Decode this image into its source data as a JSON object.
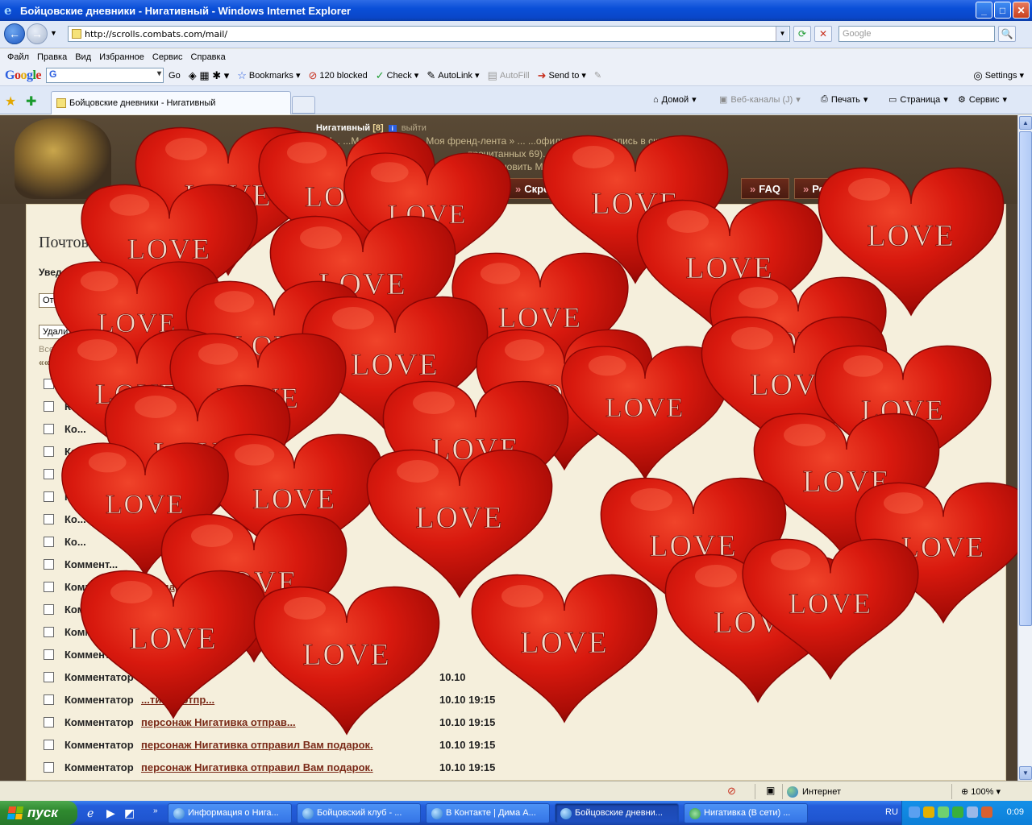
{
  "window": {
    "title": "Бойцовские дневники - Нигативный - Windows Internet Explorer",
    "ie_glyph": "e",
    "minimize": "_",
    "maximize": "□",
    "close": "✕"
  },
  "address": {
    "url": "http://scrolls.combats.com/mail/",
    "search_placeholder": "Google",
    "back": "←",
    "forward": "→",
    "refresh": "⟳",
    "stop": "✕",
    "search_go": "🔍"
  },
  "menu": [
    "Файл",
    "Правка",
    "Вид",
    "Избранное",
    "Сервис",
    "Справка"
  ],
  "google_toolbar": {
    "go": "Go",
    "search_value": "G",
    "bookmarks": "Bookmarks",
    "blocked": "120 blocked",
    "check": "Check",
    "autolink": "AutoLink",
    "autofill": "AutoFill",
    "send_to": "Send to",
    "settings": "Settings"
  },
  "tabs": {
    "active_tab": "Бойцовские дневники - Нигативный",
    "home": "Домой",
    "feeds": "Веб-каналы (J)",
    "print": "Печать",
    "page": "Страница",
    "tools": "Сервис"
  },
  "site": {
    "username": "Нигативный",
    "count": "[8]",
    "logout": "выйти",
    "nav_line1": "» М...     ...Моя ф... ...рея » Моя френд-лента » ... ...офиль » Со... ...запись в скролле",
    "nav_line2": "...прочитанных 69). » ...рок... ...облов",
    "nav_line3": "...тановить Mus...",
    "tab_scrolls": "Скро...",
    "tab_faq": "FAQ",
    "tab_rating": "Рей..."
  },
  "mail": {
    "title": "Почтовы...",
    "notifications": "Уведомления на...",
    "unsubscribe": "Отказаться ...",
    "delete": "Удалить",
    "total": "Всего пи...",
    "pager": "«« « 1"
  },
  "rows": [
    {
      "who": "Ко...",
      "msg": "",
      "time": ""
    },
    {
      "who": "Ко...",
      "msg": "",
      "time": ""
    },
    {
      "who": "Ко...",
      "msg": "",
      "time": ""
    },
    {
      "who": "Ко...",
      "msg": "",
      "time": ""
    },
    {
      "who": "Ко...",
      "msg": "",
      "time": ""
    },
    {
      "who": "Ко...",
      "msg": "",
      "time": ""
    },
    {
      "who": "Ко...",
      "msg": "",
      "time": ""
    },
    {
      "who": "Ко...",
      "msg": "",
      "time": ""
    },
    {
      "who": "Коммент...",
      "msg": "",
      "time": ""
    },
    {
      "who": "Комментат...",
      "msg": "...подарок.",
      "time": ""
    },
    {
      "who": "Коммен...",
      "msg": "",
      "time": ""
    },
    {
      "who": "Комм...",
      "msg": "",
      "time": ""
    },
    {
      "who": "Коммент...",
      "msg": "",
      "time": ""
    },
    {
      "who": "Комментатор",
      "msg": "",
      "time": "10.10"
    },
    {
      "who": "Комментатор",
      "msg": "...тивка отпр...",
      "time": "10.10 19:15"
    },
    {
      "who": "Комментатор",
      "msg": "персонаж Нигативка отправ...",
      "time": "10.10 19:15"
    },
    {
      "who": "Комментатор",
      "msg": "персонаж Нигативка отправил Вам подарок.",
      "time": "10.10 19:15"
    },
    {
      "who": "Комментатор",
      "msg": "персонаж Нигативка отправил Вам подарок.",
      "time": "10.10 19:15"
    }
  ],
  "heart_text": "LOVE",
  "hearts": [
    {
      "id": 1
    },
    {
      "id": 2
    },
    {
      "id": 3
    },
    {
      "id": 4
    },
    {
      "id": 5
    },
    {
      "id": 6
    },
    {
      "id": 7
    },
    {
      "id": 8
    },
    {
      "id": 9
    },
    {
      "id": 10
    },
    {
      "id": 11
    },
    {
      "id": 12
    },
    {
      "id": 13
    },
    {
      "id": 14
    },
    {
      "id": 15
    },
    {
      "id": 16
    },
    {
      "id": 17
    },
    {
      "id": 18
    },
    {
      "id": 19
    },
    {
      "id": 20
    },
    {
      "id": 21
    },
    {
      "id": 22
    },
    {
      "id": 23
    },
    {
      "id": 24
    },
    {
      "id": 25
    },
    {
      "id": 26
    },
    {
      "id": 27
    },
    {
      "id": 28
    },
    {
      "id": 29
    },
    {
      "id": 30
    }
  ],
  "status": {
    "zone": "Интернет",
    "zoom": "100%"
  },
  "taskbar": {
    "start": "пуск",
    "tasks": [
      "Информация о Нига...",
      "Бойцовский клуб - ...",
      "В Контакте | Дима А...",
      "Бойцовские дневни...",
      "Нигативка (В сети) ..."
    ],
    "lang": "RU",
    "clock": "0:09"
  },
  "colors": {
    "titlebar": "#0a4fd8",
    "heart": "#d8190e",
    "page_bg": "#f5efdc",
    "link": "#7a2a18"
  }
}
